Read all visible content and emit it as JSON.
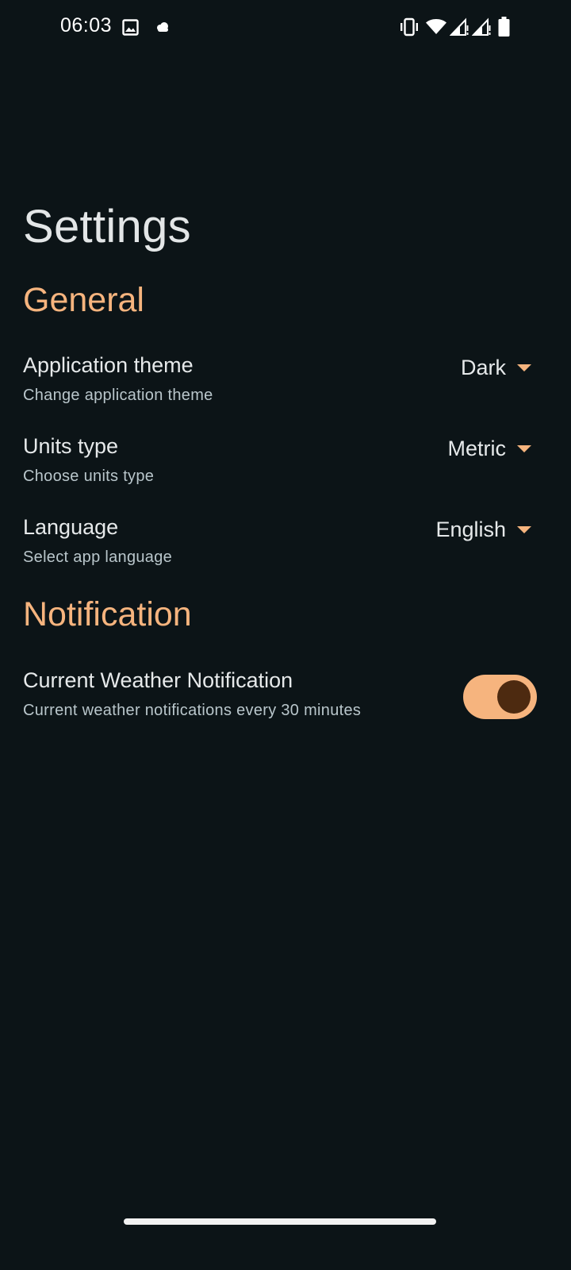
{
  "status_bar": {
    "time": "06:03",
    "left_icons": [
      "image-icon",
      "cloud-icon"
    ],
    "right_icons": [
      "vibrate-icon",
      "wifi-icon",
      "signal-icon",
      "signal-icon",
      "battery-icon"
    ]
  },
  "title": "Settings",
  "sections": {
    "general": {
      "title": "General",
      "items": [
        {
          "label": "Application theme",
          "description": "Change application theme",
          "value": "Dark"
        },
        {
          "label": "Units type",
          "description": "Choose units type",
          "value": "Metric"
        },
        {
          "label": "Language",
          "description": "Select app language",
          "value": "English"
        }
      ]
    },
    "notification": {
      "title": "Notification",
      "items": [
        {
          "label": "Current Weather Notification",
          "description": "Current weather notifications every 30 minutes",
          "enabled": true
        }
      ]
    }
  },
  "colors": {
    "background": "#0c1417",
    "accent": "#f6b47e",
    "toggle_knob": "#4d2a10",
    "text_primary": "#e6e9ea",
    "text_secondary": "#b9c6cb"
  }
}
